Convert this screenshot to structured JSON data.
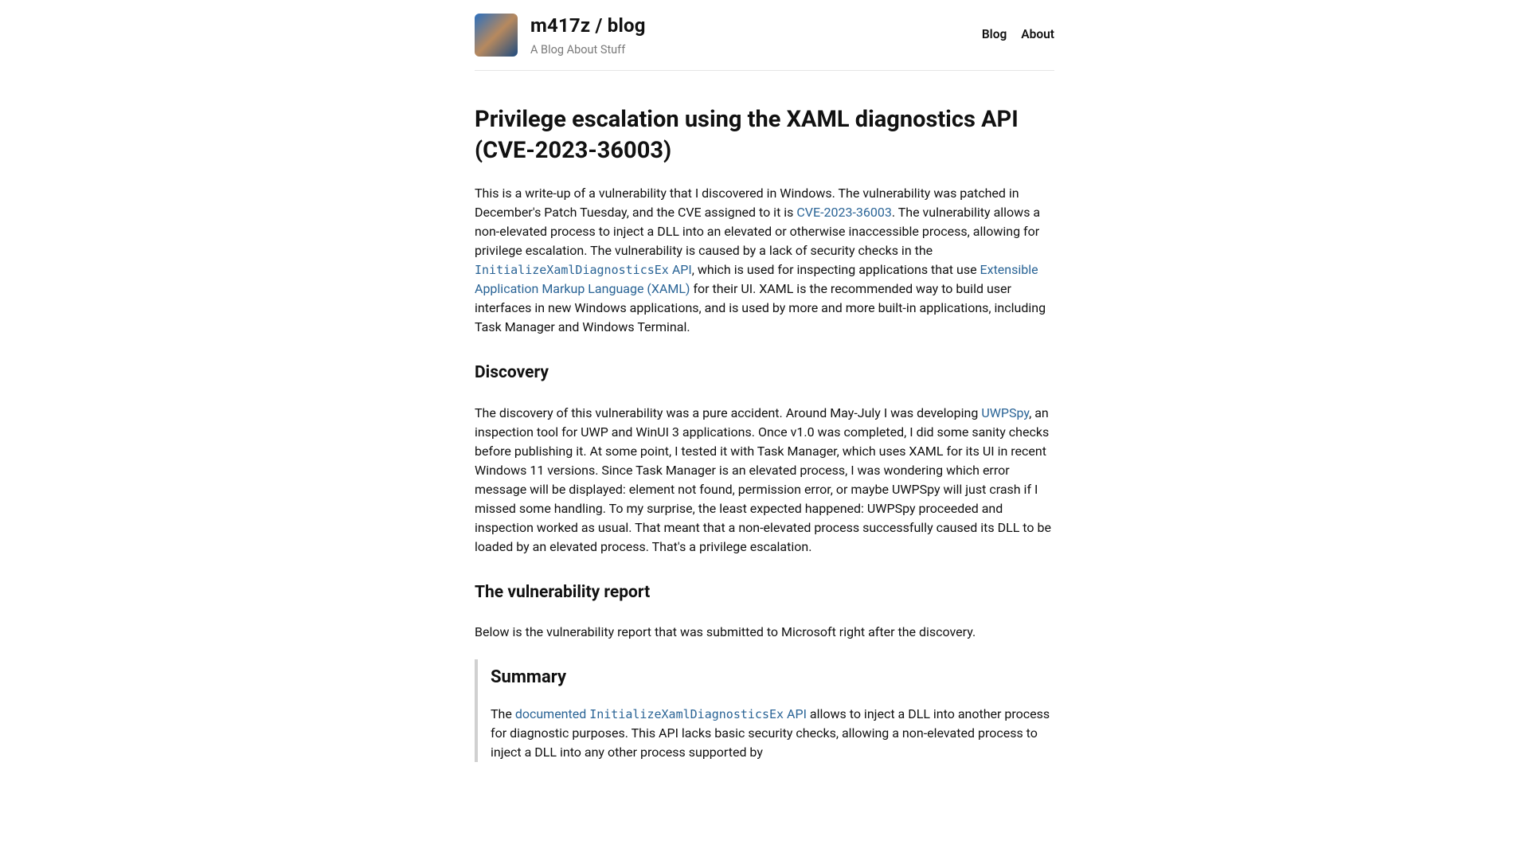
{
  "header": {
    "title": "m417z / blog",
    "tagline": "A Blog About Stuff",
    "nav": {
      "blog": "Blog",
      "about": "About"
    }
  },
  "post": {
    "title": "Privilege escalation using the XAML diagnostics API (CVE-2023-36003)",
    "intro": {
      "t1": "This is a write-up of a vulnerability that I discovered in Windows. The vulnerability was patched in December's Patch Tuesday, and the CVE assigned to it is ",
      "cve_link": "CVE-2023-36003",
      "t2": ". The vulnerability allows a non-elevated process to inject a DLL into an elevated or otherwise inaccessible process, allowing for privilege escalation. The vulnerability is caused by a lack of security checks in the ",
      "api_code": "InitializeXamlDiagnosticsEx",
      "api_link_tail": " API",
      "t3": ", which is used for inspecting applications that use ",
      "xaml_link": "Extensible Application Markup Language (XAML)",
      "t4": " for their UI. XAML is the recommended way to build user interfaces in new Windows applications, and is used by more and more built-in applications, including Task Manager and Windows Terminal."
    },
    "discovery": {
      "heading": "Discovery",
      "t1": "The discovery of this vulnerability was a pure accident. Around May-July I was developing ",
      "uwpspy_link": "UWPSpy",
      "t2": ", an inspection tool for UWP and WinUI 3 applications. Once v1.0 was completed, I did some sanity checks before publishing it. At some point, I tested it with Task Manager, which uses XAML for its UI in recent Windows 11 versions. Since Task Manager is an elevated process, I was wondering which error message will be displayed: element not found, permission error, or maybe UWPSpy will just crash if I missed some handling. To my surprise, the least expected happened: UWPSpy proceeded and inspection worked as usual. That meant that a non-elevated process successfully caused its DLL to be loaded by an elevated process. That's a privilege escalation."
    },
    "report": {
      "heading": "The vulnerability report",
      "lead": "Below is the vulnerability report that was submitted to Microsoft right after the discovery.",
      "summary_heading": "Summary",
      "s_t1": "The ",
      "s_link_pre": "documented ",
      "s_code": "InitializeXamlDiagnosticsEx",
      "s_link_post": " API",
      "s_t2": " allows to inject a DLL into another process for diagnostic purposes. This API lacks basic security checks, allowing a non-elevated process to inject a DLL into any other process supported by"
    }
  }
}
